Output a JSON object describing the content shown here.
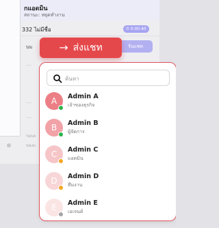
{
  "background": {
    "chat_title": "กแอดมิน",
    "chat_subtitle": "สถานะ: หยุดทำงาน",
    "conversation_name": "332 ไม่มีชื่อ",
    "timer": "0:00:40",
    "row_text": "บม",
    "accept_label": "รับแชท",
    "faint_label_1": "รอบล",
    "faint_label_2": "ของบ"
  },
  "transfer_button": {
    "label": "ส่งแชท",
    "icon": "arrow-right-icon"
  },
  "search": {
    "placeholder": "ค้นหา",
    "icon": "search-icon"
  },
  "agents": [
    {
      "initial": "A",
      "name": "Admin A",
      "role": "เจ้าของธุรกิจ",
      "avatar_color": "#ec7f86",
      "status_color": "#2bb34b"
    },
    {
      "initial": "B",
      "name": "Admin B",
      "role": "ผู้จัดการ",
      "avatar_color": "#f2a2a7",
      "status_color": "#2bb34b"
    },
    {
      "initial": "C",
      "name": "Admin C",
      "role": "แอดมิน",
      "avatar_color": "#f6c5c7",
      "status_color": "#f5a623"
    },
    {
      "initial": "D",
      "name": "Admin D",
      "role": "ทีมงาน",
      "avatar_color": "#f8d6d7",
      "status_color": "#f5a623"
    },
    {
      "initial": "E",
      "name": "Admin E",
      "role": "เอเจนต์",
      "avatar_color": "#fae4e4",
      "status_color": "#a3a3a3"
    }
  ],
  "colors": {
    "accent": "#e5484b",
    "panel_border": "#e0505a"
  }
}
